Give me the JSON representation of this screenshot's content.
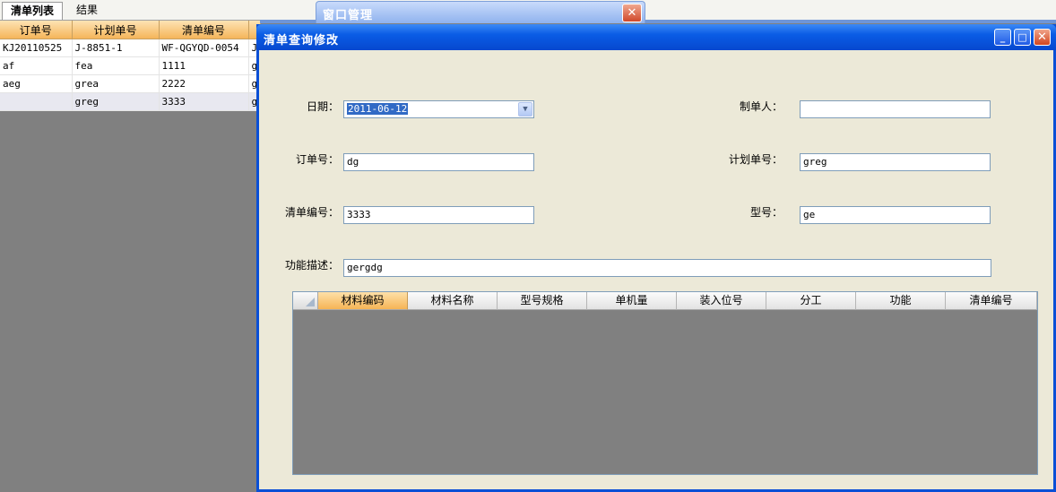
{
  "tabs": [
    {
      "label": "清单列表"
    },
    {
      "label": "结果"
    }
  ],
  "bg_grid": {
    "columns": [
      "订单号",
      "计划单号",
      "清单编号"
    ],
    "rows": [
      [
        "KJ20110525",
        "J-8851-1",
        "WF-QGYQD-0054"
      ],
      [
        "af",
        "fea",
        "1111"
      ],
      [
        "aeg",
        "grea",
        "2222"
      ],
      [
        "",
        "greg",
        "3333"
      ]
    ],
    "overflow_chars": [
      "J",
      "g",
      "g",
      "g"
    ]
  },
  "window_manager": {
    "title": "窗口管理",
    "close": "✕"
  },
  "dialog": {
    "title": "清单查询修改",
    "buttons": {
      "minimize": "_",
      "maximize": "□",
      "close": "✕"
    }
  },
  "form": {
    "date_label": "日期：",
    "date_value": "2011-06-12",
    "creator_label": "制单人：",
    "creator_value": "",
    "order_label": "订单号：",
    "order_value": "dg",
    "plan_label": "计划单号：",
    "plan_value": "greg",
    "list_label": "清单编号：",
    "list_value": "3333",
    "model_label": "型号：",
    "model_value": "ge",
    "desc_label": "功能描述：",
    "desc_value": "gergdg"
  },
  "detail_grid": {
    "columns": [
      "材料编码",
      "材料名称",
      "型号规格",
      "单机量",
      "装入位号",
      "分工",
      "功能",
      "清单编号"
    ]
  },
  "icons": {
    "combo_arrow": "▼"
  }
}
